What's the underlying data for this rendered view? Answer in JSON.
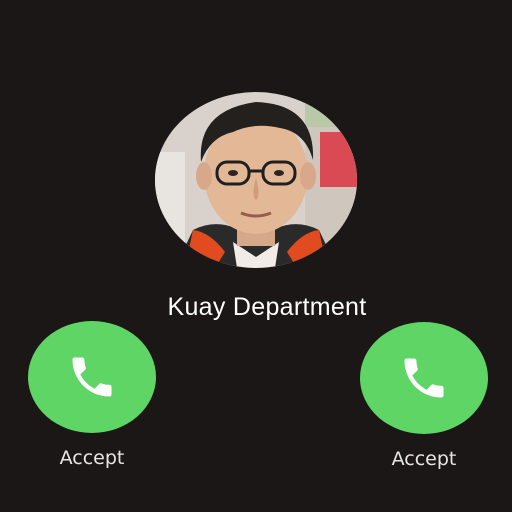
{
  "call": {
    "caller_name": "Kuay Department"
  },
  "avatar": {
    "icon": "person-photo"
  },
  "actions": {
    "left": {
      "label": "Accept",
      "icon": "phone-icon"
    },
    "right": {
      "label": "Accept",
      "icon": "phone-icon"
    }
  },
  "colors": {
    "background": "#1c1717",
    "accept_green": "#5fd566",
    "text": "#ffffff"
  }
}
